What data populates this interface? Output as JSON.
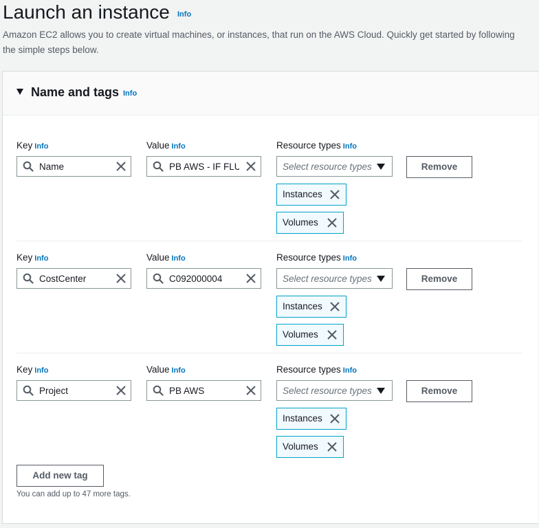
{
  "page": {
    "title": "Launch an instance",
    "title_info": "Info",
    "intro": "Amazon EC2 allows you to create virtual machines, or instances, that run on the AWS Cloud. Quickly get started by following the simple steps below."
  },
  "section": {
    "title": "Name and tags",
    "info": "Info",
    "labels": {
      "key": "Key",
      "value": "Value",
      "resource_types": "Resource types",
      "info": "Info"
    },
    "resource_placeholder": "Select resource types",
    "remove_label": "Remove",
    "tags": [
      {
        "key": "Name",
        "value": "PB AWS -  IF FLUX",
        "resource_types": [
          "Instances",
          "Volumes"
        ]
      },
      {
        "key": "CostCenter",
        "value": "C092000004",
        "resource_types": [
          "Instances",
          "Volumes"
        ]
      },
      {
        "key": "Project",
        "value": "PB AWS",
        "resource_types": [
          "Instances",
          "Volumes"
        ]
      }
    ],
    "add_tag_label": "Add new tag",
    "remaining_hint": "You can add up to 47 more tags."
  },
  "colors": {
    "link": "#0073bb",
    "token_border": "#00a1c9",
    "token_bg": "#f1faff",
    "text": "#16191f"
  }
}
